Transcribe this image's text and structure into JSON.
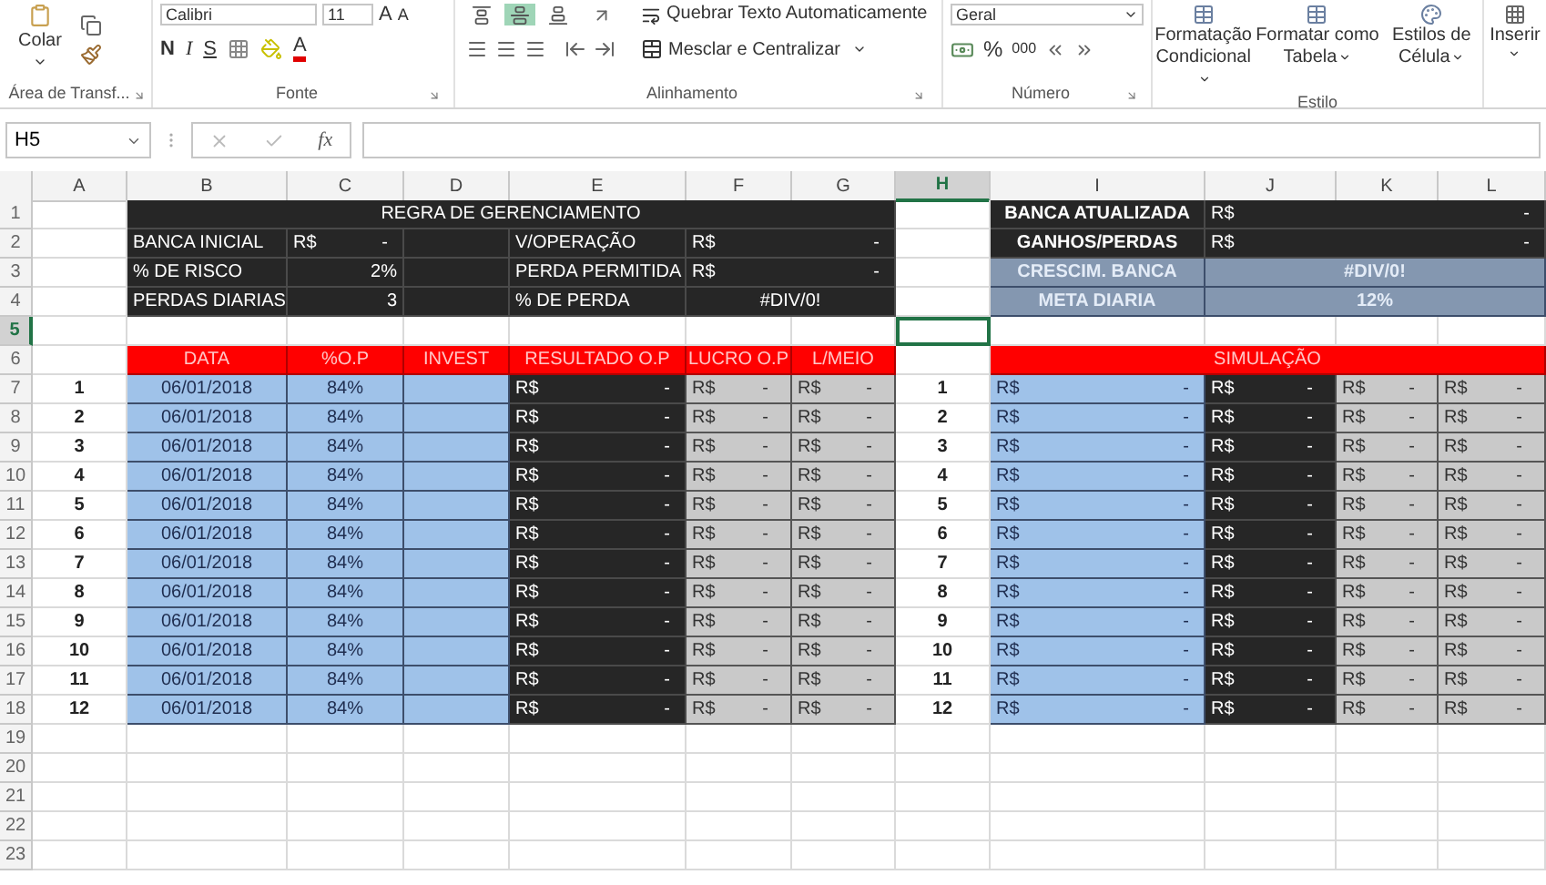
{
  "ribbon": {
    "clipboard": {
      "paste": "Colar",
      "label": "Área de Transf..."
    },
    "font": {
      "font_name": "Calibri",
      "font_size": "11",
      "grow": "A",
      "shrink": "A",
      "bold": "N",
      "italic": "I",
      "underline": "S",
      "font_color": "A",
      "label": "Fonte"
    },
    "alignment": {
      "vertical_align": [
        {
          "selected": false
        },
        {
          "selected": true
        },
        {
          "selected": false
        }
      ],
      "wrap": "Quebrar Texto Automaticamente",
      "merge": "Mesclar e Centralizar",
      "label": "Alinhamento"
    },
    "number": {
      "format": "Geral",
      "percent": "%",
      "thousands": "000",
      "label": "Número"
    },
    "styles": {
      "buttons": [
        "Formatação Condicional",
        "Formatar como Tabela",
        "Estilos de Célula"
      ],
      "label": "Estilo"
    },
    "cells": {
      "insert": "Inserir"
    }
  },
  "formula_bar": {
    "name_box": "H5",
    "function_symbol": "fx"
  },
  "sheet": {
    "columns": [
      {
        "label": "A",
        "selected": false
      },
      {
        "label": "B",
        "selected": false
      },
      {
        "label": "C",
        "selected": false
      },
      {
        "label": "D",
        "selected": false
      },
      {
        "label": "E",
        "selected": false
      },
      {
        "label": "F",
        "selected": false
      },
      {
        "label": "G",
        "selected": false
      },
      {
        "label": "H",
        "selected": true
      },
      {
        "label": "I",
        "selected": false
      },
      {
        "label": "J",
        "selected": false
      },
      {
        "label": "K",
        "selected": false
      },
      {
        "label": "L",
        "selected": false
      }
    ],
    "rows": [
      {
        "label": "1",
        "selected": false
      },
      {
        "label": "2",
        "selected": false
      },
      {
        "label": "3",
        "selected": false
      },
      {
        "label": "4",
        "selected": false
      },
      {
        "label": "5",
        "selected": true
      },
      {
        "label": "6",
        "selected": false
      },
      {
        "label": "7",
        "selected": false
      },
      {
        "label": "8",
        "selected": false
      },
      {
        "label": "9",
        "selected": false
      },
      {
        "label": "10",
        "selected": false
      },
      {
        "label": "11",
        "selected": false
      },
      {
        "label": "12",
        "selected": false
      },
      {
        "label": "13",
        "selected": false
      },
      {
        "label": "14",
        "selected": false
      },
      {
        "label": "15",
        "selected": false
      },
      {
        "label": "16",
        "selected": false
      },
      {
        "label": "17",
        "selected": false
      },
      {
        "label": "18",
        "selected": false
      },
      {
        "label": "19",
        "selected": false
      },
      {
        "label": "20",
        "selected": false
      },
      {
        "label": "21",
        "selected": false
      },
      {
        "label": "22",
        "selected": false
      },
      {
        "label": "23",
        "selected": false
      }
    ],
    "management": {
      "title": "REGRA DE GERENCIAMENTO",
      "left": [
        {
          "label": "BANCA INICIAL",
          "currency": "R$",
          "value": "-"
        },
        {
          "label": "% DE RISCO",
          "value": "2%"
        },
        {
          "label": "PERDAS DIARIAS",
          "value": "3"
        }
      ],
      "right": [
        {
          "label": "V/OPERAÇÃO",
          "currency": "R$",
          "value": "-"
        },
        {
          "label": "PERDA PERMITIDA",
          "currency": "R$",
          "value": "-"
        },
        {
          "label": "% DE PERDA",
          "value": "#DIV/0!"
        }
      ]
    },
    "bank": [
      {
        "kind": "dark",
        "label": "BANCA ATUALIZADA",
        "currency": "R$",
        "value": "-"
      },
      {
        "kind": "dark",
        "label": "GANHOS/PERDAS",
        "currency": "R$",
        "value": "-"
      },
      {
        "kind": "slate",
        "label": "CRESCIM. BANCA",
        "value": "#DIV/0!"
      },
      {
        "kind": "slate",
        "label": "META DIARIA",
        "value": "12%"
      }
    ],
    "table_headers": [
      "DATA",
      "%O.P",
      "INVEST",
      "RESULTADO O.P",
      "LUCRO O.P",
      "L/MEIO"
    ],
    "simulation_title": "SIMULAÇÃO",
    "records": [
      {
        "n": "1",
        "date": "06/01/2018",
        "op": "84%",
        "result": [
          "R$",
          "-"
        ],
        "profit": [
          "R$",
          "-"
        ],
        "half": [
          "R$",
          "-"
        ],
        "sim_n": "1",
        "simulation": [
          [
            "R$",
            "-"
          ],
          [
            "R$",
            "-"
          ],
          [
            "R$",
            "-"
          ],
          [
            "R$",
            "-"
          ]
        ]
      },
      {
        "n": "2",
        "date": "06/01/2018",
        "op": "84%",
        "result": [
          "R$",
          "-"
        ],
        "profit": [
          "R$",
          "-"
        ],
        "half": [
          "R$",
          "-"
        ],
        "sim_n": "2",
        "simulation": [
          [
            "R$",
            "-"
          ],
          [
            "R$",
            "-"
          ],
          [
            "R$",
            "-"
          ],
          [
            "R$",
            "-"
          ]
        ]
      },
      {
        "n": "3",
        "date": "06/01/2018",
        "op": "84%",
        "result": [
          "R$",
          "-"
        ],
        "profit": [
          "R$",
          "-"
        ],
        "half": [
          "R$",
          "-"
        ],
        "sim_n": "3",
        "simulation": [
          [
            "R$",
            "-"
          ],
          [
            "R$",
            "-"
          ],
          [
            "R$",
            "-"
          ],
          [
            "R$",
            "-"
          ]
        ]
      },
      {
        "n": "4",
        "date": "06/01/2018",
        "op": "84%",
        "result": [
          "R$",
          "-"
        ],
        "profit": [
          "R$",
          "-"
        ],
        "half": [
          "R$",
          "-"
        ],
        "sim_n": "4",
        "simulation": [
          [
            "R$",
            "-"
          ],
          [
            "R$",
            "-"
          ],
          [
            "R$",
            "-"
          ],
          [
            "R$",
            "-"
          ]
        ]
      },
      {
        "n": "5",
        "date": "06/01/2018",
        "op": "84%",
        "result": [
          "R$",
          "-"
        ],
        "profit": [
          "R$",
          "-"
        ],
        "half": [
          "R$",
          "-"
        ],
        "sim_n": "5",
        "simulation": [
          [
            "R$",
            "-"
          ],
          [
            "R$",
            "-"
          ],
          [
            "R$",
            "-"
          ],
          [
            "R$",
            "-"
          ]
        ]
      },
      {
        "n": "6",
        "date": "06/01/2018",
        "op": "84%",
        "result": [
          "R$",
          "-"
        ],
        "profit": [
          "R$",
          "-"
        ],
        "half": [
          "R$",
          "-"
        ],
        "sim_n": "6",
        "simulation": [
          [
            "R$",
            "-"
          ],
          [
            "R$",
            "-"
          ],
          [
            "R$",
            "-"
          ],
          [
            "R$",
            "-"
          ]
        ]
      },
      {
        "n": "7",
        "date": "06/01/2018",
        "op": "84%",
        "result": [
          "R$",
          "-"
        ],
        "profit": [
          "R$",
          "-"
        ],
        "half": [
          "R$",
          "-"
        ],
        "sim_n": "7",
        "simulation": [
          [
            "R$",
            "-"
          ],
          [
            "R$",
            "-"
          ],
          [
            "R$",
            "-"
          ],
          [
            "R$",
            "-"
          ]
        ]
      },
      {
        "n": "8",
        "date": "06/01/2018",
        "op": "84%",
        "result": [
          "R$",
          "-"
        ],
        "profit": [
          "R$",
          "-"
        ],
        "half": [
          "R$",
          "-"
        ],
        "sim_n": "8",
        "simulation": [
          [
            "R$",
            "-"
          ],
          [
            "R$",
            "-"
          ],
          [
            "R$",
            "-"
          ],
          [
            "R$",
            "-"
          ]
        ]
      },
      {
        "n": "9",
        "date": "06/01/2018",
        "op": "84%",
        "result": [
          "R$",
          "-"
        ],
        "profit": [
          "R$",
          "-"
        ],
        "half": [
          "R$",
          "-"
        ],
        "sim_n": "9",
        "simulation": [
          [
            "R$",
            "-"
          ],
          [
            "R$",
            "-"
          ],
          [
            "R$",
            "-"
          ],
          [
            "R$",
            "-"
          ]
        ]
      },
      {
        "n": "10",
        "date": "06/01/2018",
        "op": "84%",
        "result": [
          "R$",
          "-"
        ],
        "profit": [
          "R$",
          "-"
        ],
        "half": [
          "R$",
          "-"
        ],
        "sim_n": "10",
        "simulation": [
          [
            "R$",
            "-"
          ],
          [
            "R$",
            "-"
          ],
          [
            "R$",
            "-"
          ],
          [
            "R$",
            "-"
          ]
        ]
      },
      {
        "n": "11",
        "date": "06/01/2018",
        "op": "84%",
        "result": [
          "R$",
          "-"
        ],
        "profit": [
          "R$",
          "-"
        ],
        "half": [
          "R$",
          "-"
        ],
        "sim_n": "11",
        "simulation": [
          [
            "R$",
            "-"
          ],
          [
            "R$",
            "-"
          ],
          [
            "R$",
            "-"
          ],
          [
            "R$",
            "-"
          ]
        ]
      },
      {
        "n": "12",
        "date": "06/01/2018",
        "op": "84%",
        "result": [
          "R$",
          "-"
        ],
        "profit": [
          "R$",
          "-"
        ],
        "half": [
          "R$",
          "-"
        ],
        "sim_n": "12",
        "simulation": [
          [
            "R$",
            "-"
          ],
          [
            "R$",
            "-"
          ],
          [
            "R$",
            "-"
          ],
          [
            "R$",
            "-"
          ]
        ]
      }
    ]
  }
}
